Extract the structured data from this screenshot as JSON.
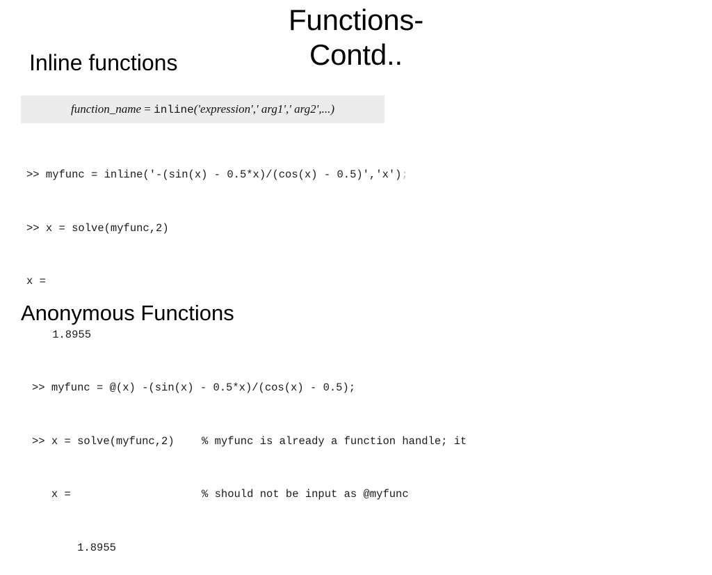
{
  "slide": {
    "main_title": "Functions-\nContd..",
    "subtitle_left": "Inline functions",
    "section_heading": "Anonymous Functions",
    "background_color": "#ffffff",
    "signature_box_color": "#ececec"
  },
  "signature": {
    "func_name": "function_name",
    "equals": " = ",
    "call_name": "inline",
    "open_paren": "(",
    "arg_expression": "'expression'",
    "sep1": ",",
    "arg_1": "' arg1'",
    "sep2": ",",
    "arg_2": "' arg2'",
    "sep3": ",",
    "ellipsis": "...",
    "close_paren": ")"
  },
  "inline_example": {
    "line_1_main": ">> myfunc = inline('-(sin(x) - 0.5*x)/(cos(x) - 0.5)','x')",
    "line_1_trailing": ";",
    "line_2": ">> x = solve(myfunc,2)",
    "line_3": "x =",
    "line_4": "    1.8955"
  },
  "anonymous_example": {
    "line_1": ">> myfunc = @(x) -(sin(x) - 0.5*x)/(cos(x) - 0.5);",
    "line_2_code": ">> x = solve(myfunc,2)",
    "line_2_comment": "% myfunc is already a function handle; it",
    "line_3_code": "   x =",
    "line_3_comment": "% should not be input as @myfunc",
    "line_4": "       1.8955"
  }
}
